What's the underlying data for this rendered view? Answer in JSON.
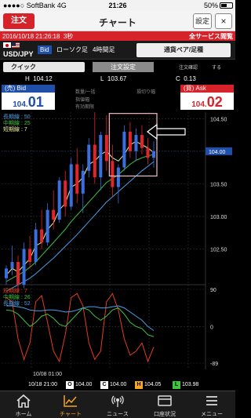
{
  "status": {
    "carrier": "SoftBank",
    "network": "4G",
    "time": "21:26",
    "battery": "50%"
  },
  "nav": {
    "order_label": "注文",
    "title": "チャート",
    "settings_label": "設定",
    "close_icon": "close-icon",
    "close_glyph": "×"
  },
  "timestamp_bar": {
    "timestamp": "2016/10/18 21:26:18",
    "interval": "3秒",
    "service": "全サービス閲覧"
  },
  "instrument": {
    "pair": "USD/JPY",
    "side_badge": "Bid",
    "candle_type": "ローソク足",
    "timeframe": "4時間足",
    "pair_button": "通貨ペア/足種"
  },
  "order_panel": {
    "quick_label": "クイック",
    "order_settings_label": "注文設定",
    "confirm_label": "注文確認",
    "confirm_value": "する"
  },
  "hlc": {
    "h_label": "H",
    "h_value": "104.12",
    "l_label": "L",
    "l_value": "103.67",
    "c_label": "C",
    "c_value": "0.13"
  },
  "bid": {
    "header": "(売) Bid",
    "prefix": "104.",
    "main": "01"
  },
  "ask": {
    "header": "(買) Ask",
    "prefix": "104.",
    "main": "02"
  },
  "order_fields": {
    "qty_label": "数量/一括",
    "range_label": "損切り幅",
    "limit_label": "指値幅",
    "expiry_label": "有効期限"
  },
  "chart_data": [
    {
      "type": "candlestick",
      "legend": [
        "長期線 : 50",
        "中期線 : 25",
        "短期線 : 7"
      ],
      "legend_colors": [
        "#4a9fe8",
        "#3ec43e",
        "#f1f0a0"
      ],
      "ylim": [
        102.0,
        104.6
      ],
      "yticks": [
        "104.50",
        "104.00",
        "103.50",
        "103.00",
        "102.50"
      ],
      "current_price_label": "104.00",
      "annotation": "highlight box with arrow pointing at latest candles",
      "candles": [
        [
          102.05,
          102.25,
          101.95,
          102.2
        ],
        [
          102.2,
          102.55,
          102.1,
          102.3
        ],
        [
          102.3,
          102.4,
          101.85,
          101.95
        ],
        [
          101.95,
          102.6,
          101.9,
          102.5
        ],
        [
          102.5,
          102.7,
          102.2,
          102.3
        ],
        [
          102.3,
          102.9,
          102.25,
          102.8
        ],
        [
          102.8,
          103.1,
          102.5,
          102.6
        ],
        [
          102.6,
          103.2,
          102.55,
          103.1
        ],
        [
          103.1,
          103.4,
          102.8,
          102.95
        ],
        [
          102.95,
          103.6,
          102.9,
          103.55
        ],
        [
          103.55,
          103.7,
          103.0,
          103.15
        ],
        [
          103.15,
          103.9,
          103.1,
          103.8
        ],
        [
          103.8,
          104.05,
          103.2,
          103.35
        ],
        [
          103.35,
          103.8,
          103.05,
          103.7
        ],
        [
          103.7,
          104.2,
          103.6,
          104.1
        ],
        [
          104.1,
          104.6,
          103.5,
          103.6
        ],
        [
          103.6,
          104.3,
          103.4,
          104.25
        ],
        [
          104.25,
          104.55,
          103.7,
          103.85
        ],
        [
          103.85,
          104.1,
          103.3,
          103.45
        ],
        [
          103.45,
          103.8,
          103.2,
          103.75
        ],
        [
          103.75,
          104.4,
          103.7,
          104.3
        ],
        [
          104.3,
          104.45,
          103.9,
          104.0
        ],
        [
          104.0,
          104.35,
          103.85,
          104.25
        ],
        [
          104.25,
          104.4,
          103.95,
          104.05
        ],
        [
          104.05,
          104.2,
          103.8,
          103.9
        ],
        [
          103.9,
          104.15,
          103.75,
          104.0
        ]
      ],
      "ma_long": [
        101.85,
        101.9,
        101.95,
        102.0,
        102.05,
        102.12,
        102.2,
        102.28,
        102.36,
        102.45,
        102.54,
        102.63,
        102.72,
        102.82,
        102.92,
        103.02,
        103.12,
        103.22,
        103.3,
        103.38,
        103.46,
        103.54,
        103.62,
        103.7,
        103.77,
        103.84
      ],
      "ma_mid": [
        102.0,
        102.05,
        102.1,
        102.15,
        102.22,
        102.3,
        102.4,
        102.5,
        102.6,
        102.7,
        102.8,
        102.92,
        103.02,
        103.12,
        103.22,
        103.32,
        103.42,
        103.52,
        103.58,
        103.64,
        103.72,
        103.8,
        103.86,
        103.9,
        103.93,
        103.95
      ],
      "ma_short": [
        102.1,
        102.2,
        102.15,
        102.25,
        102.35,
        102.55,
        102.6,
        102.8,
        102.9,
        103.1,
        103.2,
        103.45,
        103.5,
        103.6,
        103.8,
        103.85,
        103.95,
        104.0,
        103.9,
        103.85,
        103.95,
        104.1,
        104.15,
        104.1,
        104.05,
        103.98
      ]
    },
    {
      "type": "line",
      "legend": [
        "短期線 : 7",
        "中期線 : 26",
        "長期線 : 52"
      ],
      "legend_colors": [
        "#e63b1f",
        "#3ec43e",
        "#4a9fe8"
      ],
      "ylim": [
        -89,
        90
      ],
      "yticks": [
        "90",
        "0",
        "-89"
      ],
      "series": [
        {
          "values": [
            70,
            60,
            -30,
            -80,
            -40,
            60,
            75,
            10,
            -60,
            -85,
            -20,
            70,
            80,
            50,
            -40,
            -80,
            -60,
            60,
            80,
            40,
            -30,
            -70,
            -60,
            -40,
            -85,
            -50
          ]
        },
        {
          "values": [
            40,
            38,
            30,
            15,
            0,
            10,
            25,
            30,
            20,
            5,
            0,
            15,
            30,
            45,
            40,
            25,
            15,
            25,
            40,
            45,
            30,
            10,
            0,
            -5,
            -20,
            -25
          ]
        },
        {
          "values": [
            50,
            50,
            48,
            45,
            40,
            38,
            38,
            40,
            40,
            38,
            35,
            36,
            40,
            45,
            48,
            48,
            45,
            45,
            48,
            50,
            45,
            35,
            25,
            15,
            0,
            -10
          ]
        }
      ]
    }
  ],
  "x_axis_label": "10/08 01:00",
  "ohlc": {
    "datetime": "10/18 21:00",
    "o_label": "O",
    "o": "104.00",
    "c_label": "C",
    "c": "104.00",
    "h_label": "H",
    "h": "104.05",
    "l_label": "L",
    "l": "103.98"
  },
  "tabs": [
    {
      "label": "ホーム",
      "icon": "home-icon"
    },
    {
      "label": "チャート",
      "icon": "chart-icon"
    },
    {
      "label": "ニュース",
      "icon": "news-icon"
    },
    {
      "label": "口座状況",
      "icon": "account-icon"
    },
    {
      "label": "メニュー",
      "icon": "menu-icon"
    }
  ]
}
